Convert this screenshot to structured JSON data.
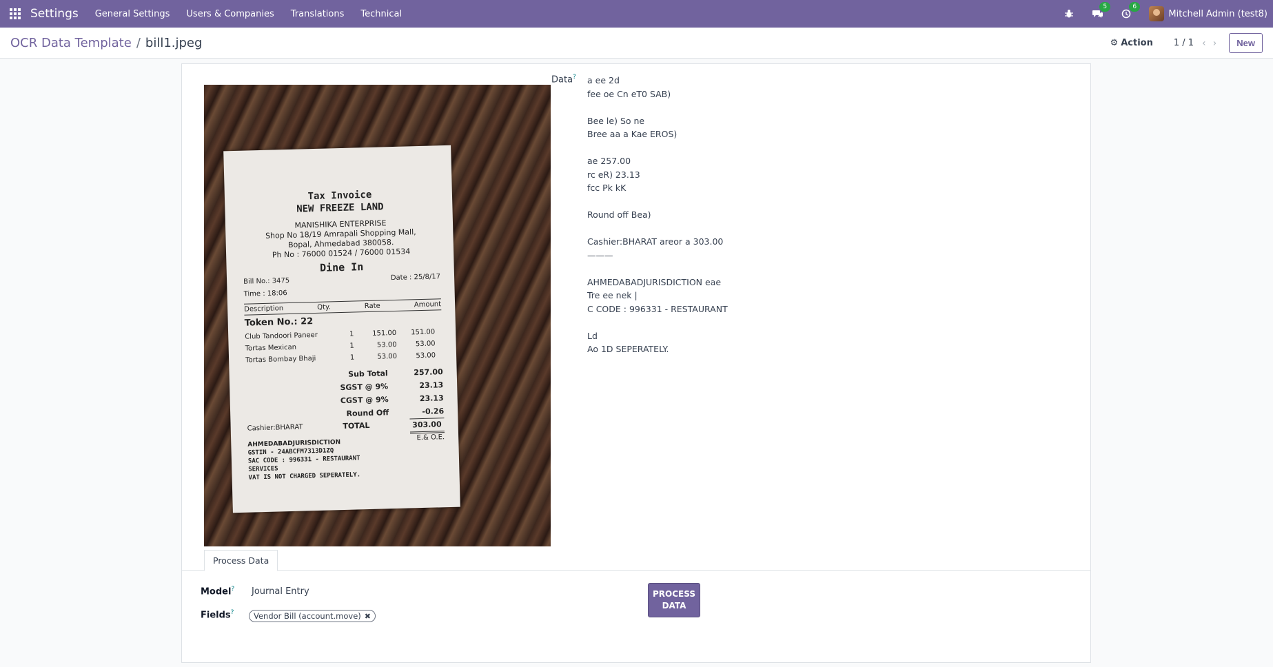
{
  "navbar": {
    "brand": "Settings",
    "items": [
      "General Settings",
      "Users & Companies",
      "Translations",
      "Technical"
    ],
    "messages_count": "5",
    "activities_count": "6",
    "user_name": "Mitchell Admin (test8)"
  },
  "control": {
    "breadcrumb_parent": "OCR Data Template",
    "breadcrumb_sep": "/",
    "breadcrumb_current": "bill1.jpeg",
    "action_label": "Action",
    "pager": "1 / 1",
    "new_label": "New"
  },
  "receipt": {
    "title1": "Tax Invoice",
    "title2": "NEW FREEZE LAND",
    "company": "MANISHIKA ENTERPRISE",
    "addr1": "Shop No 18/19 Amrapali Shopping Mall,",
    "addr2": "Bopal, Ahmedabad 380058.",
    "phone": "Ph No : 76000 01524 / 76000 01534",
    "dine": "Dine In",
    "bill_no": "Bill No.: 3475",
    "date": "Date : 25/8/17",
    "time": "Time : 18:06",
    "headers": [
      "Description",
      "Qty.",
      "Rate",
      "Amount"
    ],
    "token": "Token No.:  22",
    "items": [
      {
        "d": "Club Tandoori Paneer",
        "q": "1",
        "r": "151.00",
        "a": "151.00"
      },
      {
        "d": "Tortas Mexican",
        "q": "1",
        "r": "53.00",
        "a": "53.00"
      },
      {
        "d": "Tortas Bombay Bhaji",
        "q": "1",
        "r": "53.00",
        "a": "53.00"
      }
    ],
    "totals": [
      {
        "l": "Sub Total",
        "v": "257.00"
      },
      {
        "l": "SGST @ 9%",
        "v": "23.13"
      },
      {
        "l": "CGST @ 9%",
        "v": "23.13"
      },
      {
        "l": "Round Off",
        "v": "-0.26"
      },
      {
        "l": "TOTAL",
        "v": "303.00"
      }
    ],
    "cashier": "Cashier:BHARAT",
    "eoe": "E.& O.E.",
    "foot1": "AHMEDABADJURISDICTION",
    "foot2": "GSTIN - 24ABCFM7313D1ZQ",
    "foot3": "SAC CODE : 996331 - RESTAURANT",
    "foot4": "SERVICES",
    "foot5": "VAT IS NOT CHARGED SEPERATELY."
  },
  "form": {
    "data_label": "Data",
    "help_mark": "?",
    "ocr_lines": [
      "a ee 2d",
      "fee oe Cn eT0 SAB)",
      "",
      "Bee le) So ne",
      "Bree aa a Kae EROS)",
      "",
      "ae 257.00",
      "rc eR) 23.13",
      "fcc Pk kK",
      "",
      "Round off Bea)",
      "",
      "Cashier:BHARAT areor a 303.00",
      "———",
      "",
      "AHMEDABADJURISDICTION eae",
      "Tre ee nek |",
      "C CODE : 996331 - RESTAURANT",
      "",
      "Ld",
      "Ao 1D SEPERATELY."
    ],
    "tab_label": "Process Data",
    "model_label": "Model",
    "model_value": "Journal Entry",
    "fields_label": "Fields",
    "fields_tag": "Vendor Bill (account.move)",
    "process_btn_line1": "PROCESS",
    "process_btn_line2": "DATA"
  },
  "colors": {
    "brand": "#71639e",
    "badge": "#28a745",
    "help": "#017e84"
  }
}
